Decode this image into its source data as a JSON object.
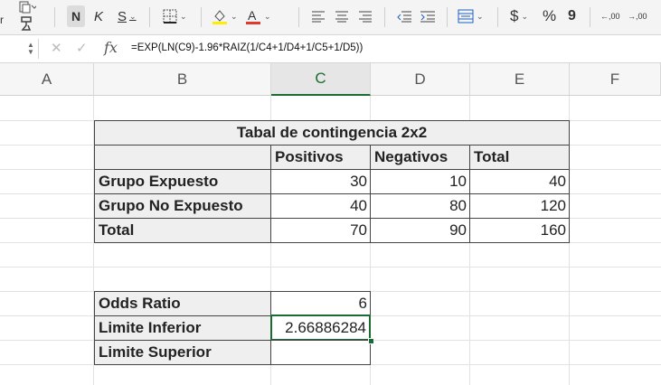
{
  "toolbar": {
    "left_fragment": "r",
    "bold": "N",
    "italic": "K",
    "underline": "S",
    "currency": "$",
    "percent": "%",
    "comma": "9",
    "decrease_decimal": ",00",
    "increase_decimal": ",00",
    "icons": [
      "paste-icon",
      "format-painter-icon",
      "borders-icon",
      "fill-color-icon",
      "font-color-icon",
      "align-left-icon",
      "align-center-icon",
      "align-right-icon",
      "decrease-indent-icon",
      "increase-indent-icon",
      "merge-center-icon"
    ],
    "accent_fill": "#ffee00",
    "accent_font": "#e03a2f"
  },
  "formula_bar": {
    "fx": "fx",
    "formula": "=EXP(LN(C9)-1.96*RAIZ(1/C4+1/D4+1/C5+1/D5))"
  },
  "columns": [
    "A",
    "B",
    "C",
    "D",
    "E",
    "F"
  ],
  "active_column": "C",
  "table": {
    "title": "Tabal de contingencia 2x2",
    "headers": [
      "Positivos",
      "Negativos",
      "Total"
    ],
    "rows": [
      {
        "label": "Grupo Expuesto",
        "values": [
          "30",
          "10",
          "40"
        ]
      },
      {
        "label": "Grupo No Expuesto",
        "values": [
          "40",
          "80",
          "120"
        ]
      },
      {
        "label": "Total",
        "values": [
          "70",
          "90",
          "160"
        ]
      }
    ]
  },
  "odds": {
    "rows": [
      {
        "label": "Odds Ratio",
        "value": "6"
      },
      {
        "label": "Limite Inferior",
        "value": "2.66886284"
      },
      {
        "label": "Limite Superior",
        "value": ""
      }
    ]
  },
  "colors": {
    "selection": "#1d6b34",
    "header_gray": "#efefef"
  }
}
